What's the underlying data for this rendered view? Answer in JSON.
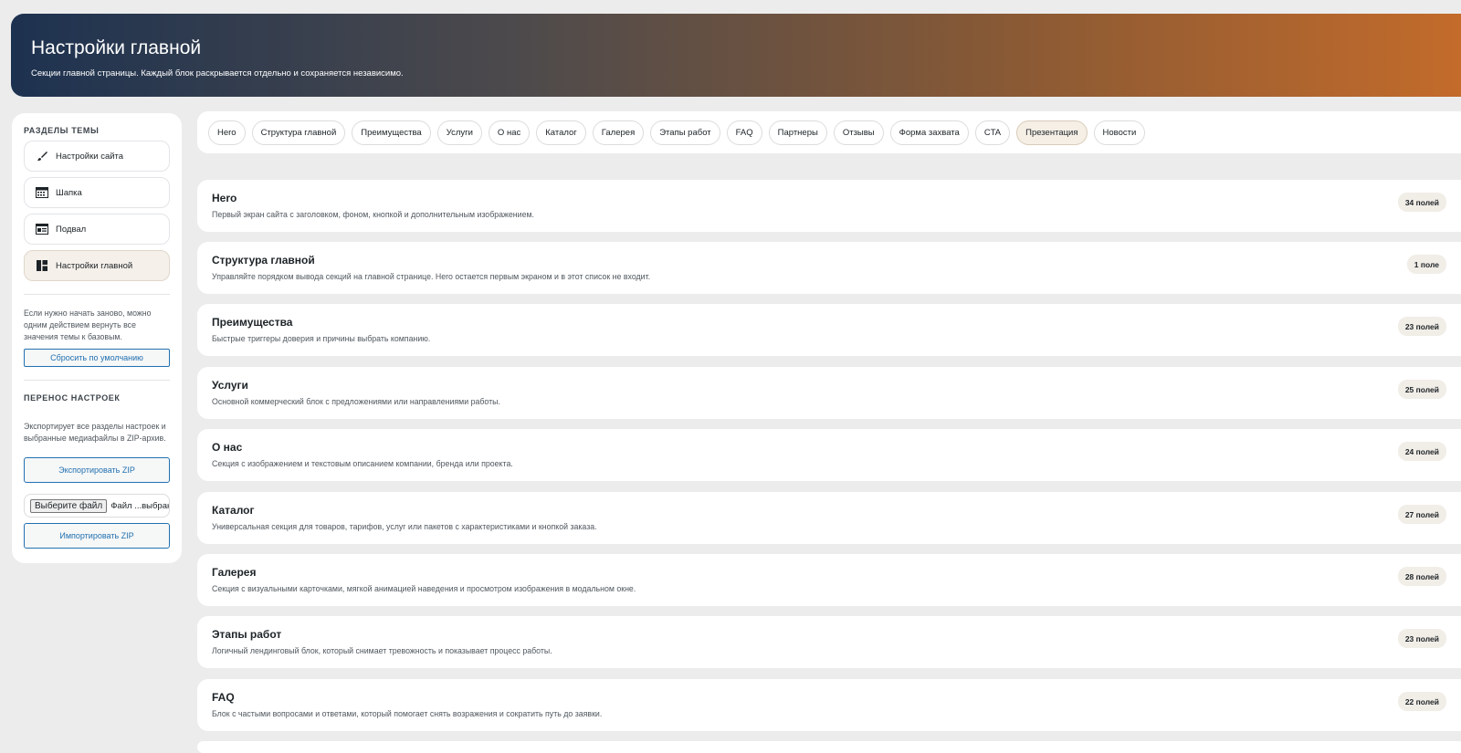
{
  "header": {
    "title": "Настройки главной",
    "subtitle": "Секции главной страницы. Каждый блок раскрывается отдельно и сохраняется независимо."
  },
  "sidebar": {
    "heading": "РАЗДЕЛЫ ТЕМЫ",
    "items": [
      {
        "label": "Настройки сайта",
        "icon": "brush-icon"
      },
      {
        "label": "Шапка",
        "icon": "header-icon"
      },
      {
        "label": "Подвал",
        "icon": "footer-icon"
      },
      {
        "label": "Настройки главной",
        "icon": "layout-icon"
      }
    ],
    "reset_note": "Если нужно начать заново, можно одним действием вернуть все значения темы к базовым.",
    "reset_label": "Сбросить по умолчанию",
    "transfer_heading": "ПЕРЕНОС НАСТРОЕК",
    "transfer_note": "Экспортирует все разделы настроек и выбранные медиафайлы в ZIP-архив.",
    "export_label": "Экспортировать ZIP",
    "file_button": "Выберите файл",
    "file_status": "Файл ...выбран",
    "import_label": "Импортировать ZIP"
  },
  "tabs": [
    "Hero",
    "Структура главной",
    "Преимущества",
    "Услуги",
    "О нас",
    "Каталог",
    "Галерея",
    "Этапы работ",
    "FAQ",
    "Партнеры",
    "Отзывы",
    "Форма захвата",
    "CTA",
    "Презентация",
    "Новости"
  ],
  "active_tab": "Презентация",
  "sections": [
    {
      "title": "Hero",
      "desc": "Первый экран сайта с заголовком, фоном, кнопкой и дополнительным изображением.",
      "count": "34 полей"
    },
    {
      "title": "Структура главной",
      "desc": "Управляйте порядком вывода секций на главной странице. Hero остается первым экраном и в этот список не входит.",
      "count": "1 поле"
    },
    {
      "title": "Преимущества",
      "desc": "Быстрые триггеры доверия и причины выбрать компанию.",
      "count": "23 полей"
    },
    {
      "title": "Услуги",
      "desc": "Основной коммерческий блок с предложениями или направлениями работы.",
      "count": "25 полей"
    },
    {
      "title": "О нас",
      "desc": "Секция с изображением и текстовым описанием компании, бренда или проекта.",
      "count": "24 полей"
    },
    {
      "title": "Каталог",
      "desc": "Универсальная секция для товаров, тарифов, услуг или пакетов с характеристиками и кнопкой заказа.",
      "count": "27 полей"
    },
    {
      "title": "Галерея",
      "desc": "Секция с визуальными карточками, мягкой анимацией наведения и просмотром изображения в модальном окне.",
      "count": "28 полей"
    },
    {
      "title": "Этапы работ",
      "desc": "Логичный лендинговый блок, который снимает тревожность и показывает процесс работы.",
      "count": "23 полей"
    },
    {
      "title": "FAQ",
      "desc": "Блок с частыми вопросами и ответами, который помогает снять возражения и сократить путь до заявки.",
      "count": "22 полей"
    }
  ]
}
